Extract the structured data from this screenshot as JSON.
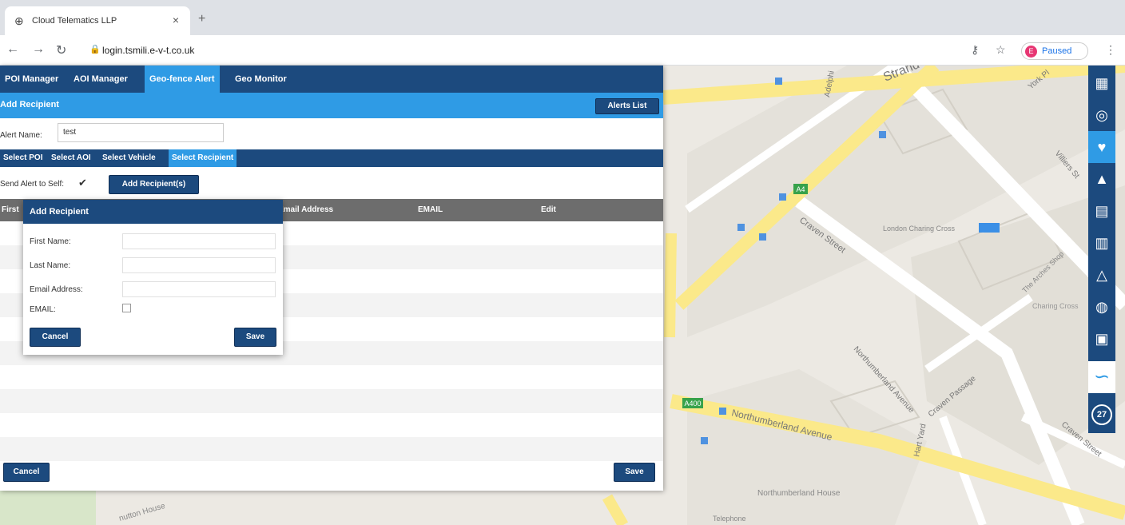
{
  "browser": {
    "tab_title": "Cloud Telematics LLP",
    "tab_close": "×",
    "new_tab": "+",
    "url": "login.tsmili.e-v-t.co.uk",
    "paused_label": "Paused",
    "profile_initial": "E"
  },
  "nav": {
    "items": [
      {
        "label": "POI Manager"
      },
      {
        "label": "AOI Manager"
      },
      {
        "label": "Geo-fence Alert"
      },
      {
        "label": "Geo Monitor"
      }
    ],
    "active": "Geo-fence Alert"
  },
  "header": {
    "title": "Add Recipient",
    "alerts_list_button": "Alerts List"
  },
  "alert_form": {
    "alert_name_label": "Alert Name:",
    "alert_name_value": "test",
    "tabs": [
      {
        "label": "Select POI"
      },
      {
        "label": "Select AOI"
      },
      {
        "label": "Select Vehicle"
      },
      {
        "label": "Select Recipient"
      }
    ],
    "active_tab": "Select Recipient",
    "send_self_label": "Send Alert to Self:",
    "add_recipients_button": "Add Recipient(s)"
  },
  "table": {
    "columns": [
      "First",
      "Email Address",
      "EMAIL",
      "Edit"
    ]
  },
  "modal": {
    "title": "Add Recipient",
    "fields": [
      {
        "label": "First Name:"
      },
      {
        "label": "Last Name:"
      },
      {
        "label": "Email Address:"
      },
      {
        "label": "EMAIL:"
      }
    ],
    "cancel_button": "Cancel",
    "save_button": "Save"
  },
  "footer": {
    "cancel_button": "Cancel",
    "save_button": "Save"
  },
  "map": {
    "labels": {
      "strand": "Strand",
      "craven_street": "Craven Street",
      "craven_passage": "Craven Passage",
      "northumberland_avenue": "Northumberland Avenue",
      "northumberland_house": "Northumberland House",
      "charing_cross": "London Charing Cross",
      "the_arches": "The Arches Shop",
      "york_place": "York Pl",
      "villiers_street": "Villiers St",
      "adelphi": "Adelphi",
      "hart_yard": "Hart Yard",
      "charing_cross_gate": "Charing Cross",
      "telephone": "Telephone",
      "nutton_house": "nutton House",
      "a4": "A4",
      "a400": "A400",
      "craven_street_2": "Craven Street"
    },
    "badge_count": "27"
  },
  "colors": {
    "nav_dark": "#1c4a7e",
    "nav_active": "#2f9be5",
    "table_header": "#6d6d6d",
    "road_yellow": "#fbe98a",
    "map_bg": "#ece9e3"
  }
}
